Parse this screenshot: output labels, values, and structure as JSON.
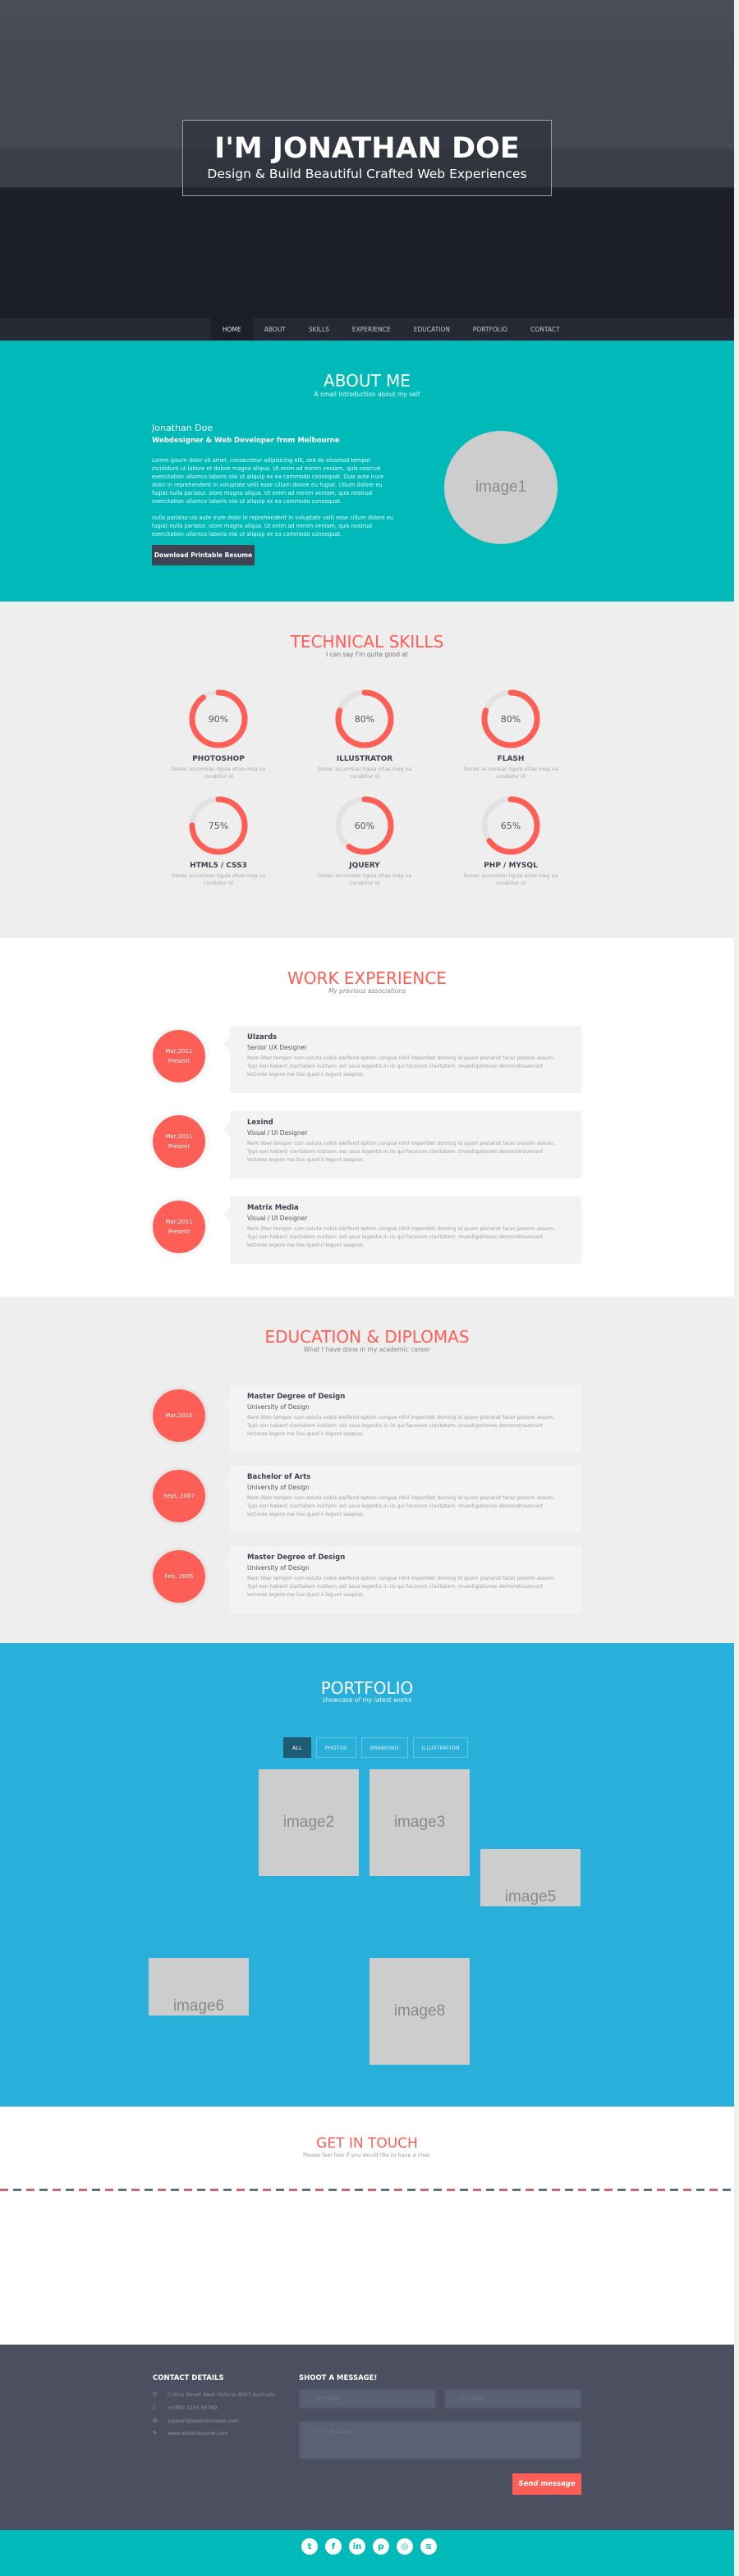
{
  "hero": {
    "title": "I'M JONATHAN DOE",
    "subtitle": "Design & Build Beautiful Crafted Web Experiences"
  },
  "nav": {
    "items": [
      {
        "label": "HOME",
        "active": true
      },
      {
        "label": "ABOUT",
        "active": false
      },
      {
        "label": "SKILLS",
        "active": false
      },
      {
        "label": "EXPERIENCE",
        "active": false
      },
      {
        "label": "EDUCATION",
        "active": false
      },
      {
        "label": "PORTFOLIO",
        "active": false
      },
      {
        "label": "CONTACT",
        "active": false
      }
    ]
  },
  "about": {
    "title": "ABOUT ME",
    "subtitle": "A small introduction about my self",
    "name": "Jonathan Doe",
    "role": "Webdesigner & Web Developer from Melbourne",
    "paragraph1": "Lorem ipsum dolor sit amet, consectetur adipisicing elit, sed do eiusmod tempor incididunt ut labore et dolore magna aliqua. Ut enim ad minim veniam, quis nostrud exercitation ullamco laboris nisi ut aliquip ex ea commodo consequat. Duis aute irure dolor in reprehenderit in voluptate velit esse cillum dolore eu fugiat. cillum dolore eu fugiat nulla pariatur. olore magna aliqua. Ut enim ad minim veniam, quis nostrud exercitation ullamco laboris nisi ut aliquip ex ea commodo consequat.",
    "paragraph2": "nulla pariatur.uis aute irure dolor in reprehenderit in voluptate velit esse cillum dolore eu fugiat nulla pariatur. olore magna aliqua. Ut enim ad minim veniam, quis nostrud exercitation ullamco laboris nisi ut aliquip ex ea commodo consequat.",
    "download_label": "Download Printable Resume",
    "image_label": "image1"
  },
  "skills": {
    "title": "TECHNICAL SKILLS",
    "subtitle": "I can say I'm quite good at",
    "items": [
      {
        "name": "PHOTOSHOP",
        "percent": 90,
        "percent_label": "90%",
        "desc": "Donec accumsan ligula vitae mag na curabitur id"
      },
      {
        "name": "ILLUSTRATOR",
        "percent": 80,
        "percent_label": "80%",
        "desc": "Donec accumsan ligula vitae mag na curabitur id"
      },
      {
        "name": "FLASH",
        "percent": 80,
        "percent_label": "80%",
        "desc": "Donec accumsan ligula vitae mag na curabitur id"
      },
      {
        "name": "HTML5 / CSS3",
        "percent": 75,
        "percent_label": "75%",
        "desc": "Donec accumsan ligula vitae mag na curabitur id"
      },
      {
        "name": "JQUERY",
        "percent": 60,
        "percent_label": "60%",
        "desc": "Donec accumsan ligula vitae mag na curabitur id"
      },
      {
        "name": "PHP / MYSQL",
        "percent": 65,
        "percent_label": "65%",
        "desc": "Donec accumsan ligula vitae mag na curabitur id"
      }
    ]
  },
  "work": {
    "title": "WORK EXPERIENCE",
    "subtitle": "My previous associations",
    "items": [
      {
        "date_line1": "Mar,2011",
        "date_line2": "Present",
        "company": "UIzards",
        "role": "Senior UX Designer",
        "desc": "Nam liber tempor cum soluta nobis eleifend option congue nihil imperdiet doming id quom placerat facer possim assum. Typi non habent claritatem insitam; est usus legentis in iis qui facorum claritatem. Investigationes demonstraverunt lectores legere me lius quod ii legunt saepius."
      },
      {
        "date_line1": "Mar,2011",
        "date_line2": "Present",
        "company": "Lexind",
        "role": "Visual / UI Designer",
        "desc": "Nam liber tempor cum soluta nobis eleifend option congue nihil imperdiet doming id quom placerat facer possim assum. Typi non habent claritatem insitam; est usus legentis in iis qui facorum claritatem. Investigationes demonstraverunt lectores legere me lius quod ii legunt saepius."
      },
      {
        "date_line1": "Mar,2011",
        "date_line2": "Present",
        "company": "Matrix Media",
        "role": "Visual / UI Designer",
        "desc": "Nam liber tempor cum soluta nobis eleifend option congue nihil imperdiet doming id quom placerat facer possim assum. Typi non habent claritatem insitam; est usus legentis in iis qui facorum claritatem. Investigationes demonstraverunt lectores legere me lius quod ii legunt saepius."
      }
    ]
  },
  "education": {
    "title": "EDUCATION & DIPLOMAS",
    "subtitle": "What I have done in my academic career",
    "items": [
      {
        "date": "Mar,2010",
        "degree": "Master Degree of Design",
        "school": "University of Design",
        "desc": "Nam liber tempor cum soluta nobis eleifend option congue nihil imperdiet doming id quom placerat facer possim assum. Typi non habent claritatem insitam; est usus legentis in iis qui facorum claritatem. Investigationes demonstraverunt lectores legere me lius quod ii legunt saepius."
      },
      {
        "date": "Sept, 2007",
        "degree": "Bachelor of Arts",
        "school": "University of Design",
        "desc": "Nam liber tempor cum soluta nobis eleifend option congue nihil imperdiet doming id quom placerat facer possim assum. Typi non habent claritatem insitam; est usus legentis in iis qui facorum claritatem. Investigationes demonstraverunt lectores legere me lius quod ii legunt saepius."
      },
      {
        "date": "Feb, 2005",
        "degree": "Master Degree of Design",
        "school": "University of Design",
        "desc": "Nam liber tempor cum soluta nobis eleifend option congue nihil imperdiet doming id quom placerat facer possim assum. Typi non habent claritatem insitam; est usus legentis in iis qui facorum claritatem. Investigationes demonstraverunt lectores legere me lius quod ii legunt saepius."
      }
    ]
  },
  "portfolio": {
    "title": "PORTFOLIO",
    "subtitle": "showcase of my latest works",
    "filters": [
      {
        "label": "ALL",
        "active": true
      },
      {
        "label": "PHOTOS",
        "active": false
      },
      {
        "label": "BRANDING",
        "active": false
      },
      {
        "label": "ILLUSTRATION",
        "active": false
      }
    ],
    "images": [
      "image2",
      "image3",
      "image5",
      "image6",
      "image8"
    ]
  },
  "contact": {
    "title": "GET IN TOUCH",
    "subtitle": "Please feel free if you would like to have a chat."
  },
  "footer": {
    "details_title": "CONTACT DETAILS",
    "address": "Collins Street West Victoria 8007 Australia",
    "phone": "+1800 1234 56789",
    "email": "support@websitename.com",
    "website": "www.websitename.com",
    "message_title": "SHOOT A MESSAGE!",
    "name_placeholder": "Your name",
    "email_placeholder": "Your email",
    "message_placeholder": "Your Message",
    "send_label": "Send message"
  },
  "social": {
    "icons": [
      "twitter-icon",
      "facebook-icon",
      "linkedin-icon",
      "pinterest-icon",
      "dribbble-icon",
      "rss-icon"
    ],
    "glyphs": [
      "t",
      "f",
      "in",
      "p",
      "◎",
      "≋"
    ]
  },
  "colors": {
    "accent": "#fd5e56",
    "teal": "#00b9b9",
    "blue": "#29b0da",
    "dark": "#4b4f60"
  }
}
